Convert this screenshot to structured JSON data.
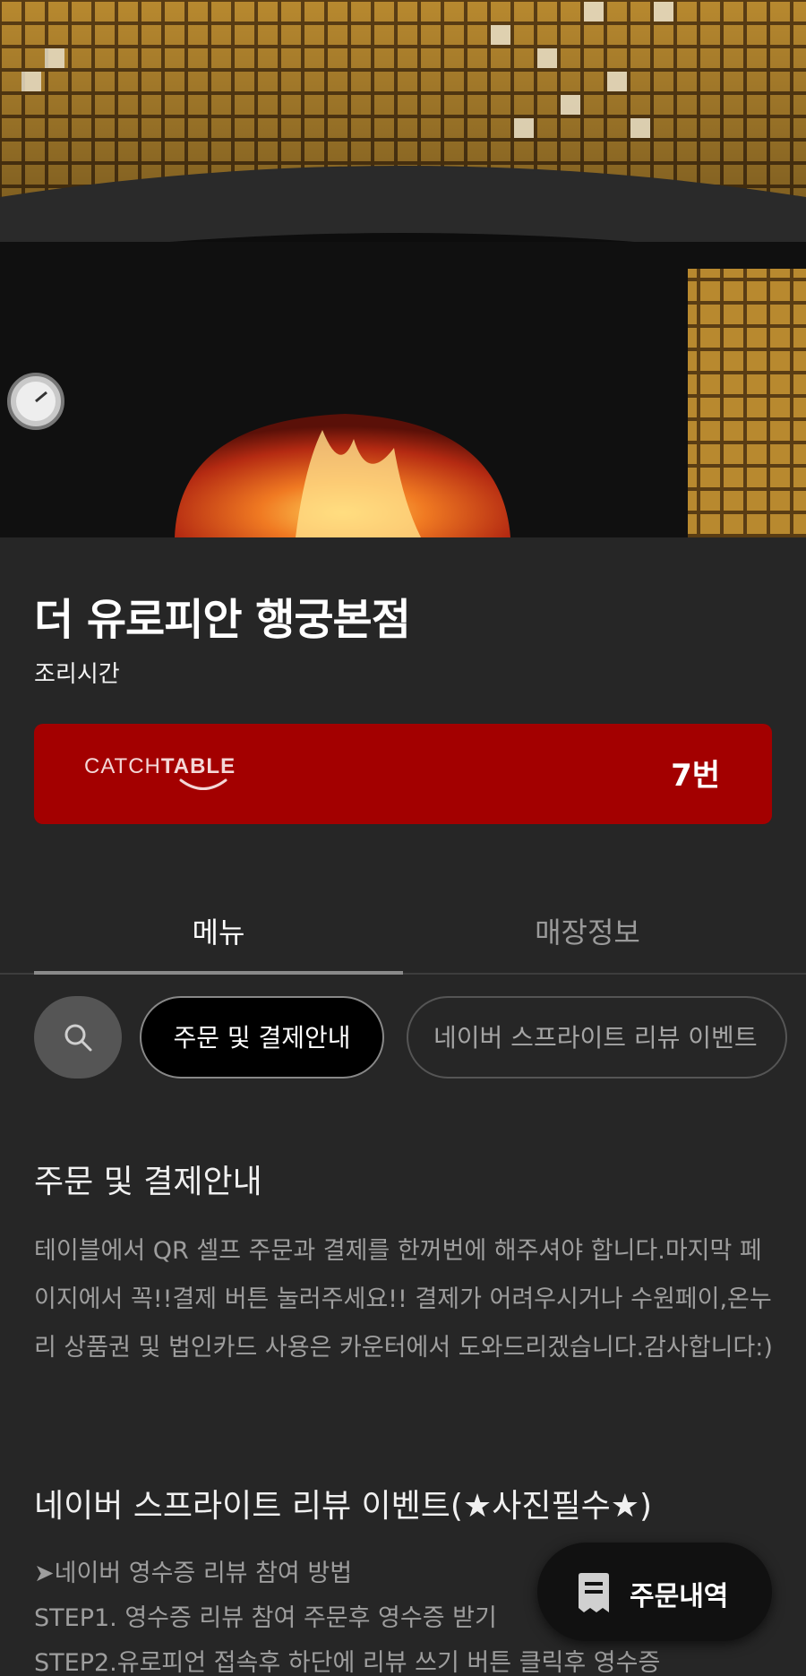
{
  "store": {
    "name": "더 유로피안 행궁본점",
    "subtitle": "조리시간"
  },
  "catchtable": {
    "logo_light": "CATCH",
    "logo_bold": "TABLE",
    "number": "7번",
    "color": "#a30000"
  },
  "tabs": [
    {
      "label": "메뉴",
      "active": true
    },
    {
      "label": "매장정보",
      "active": false
    }
  ],
  "chips": {
    "search_icon": "search-icon",
    "items": [
      {
        "label": "주문 및 결제안내",
        "active": true
      },
      {
        "label": "네이버 스프라이트 리뷰 이벤트",
        "active": false
      }
    ]
  },
  "sections": [
    {
      "title": "주문 및 결제안내",
      "body": "테이블에서 QR 셀프 주문과 결제를 한꺼번에 해주셔야 합니다.마지막 페이지에서 꼭!!결제 버튼 눌러주세요!! 결제가 어려우시거나 수원페이,온누리 상품권 및 법인카드 사용은 카운터에서 도와드리겠습니다.감사합니다:)"
    },
    {
      "title": "네이버 스프라이트 리뷰 이벤트(★사진필수★)",
      "lines": [
        "➤네이버 영수증 리뷰 참여 방법",
        "STEP1. 영수증 리뷰 참여 주문후 영수증 받기",
        "STEP2.유로피언 접속후 하단에 리뷰 쓰기 버튼 클릭후 영수증"
      ]
    }
  ],
  "order_button": {
    "label": "주문내역",
    "icon": "receipt-icon"
  }
}
